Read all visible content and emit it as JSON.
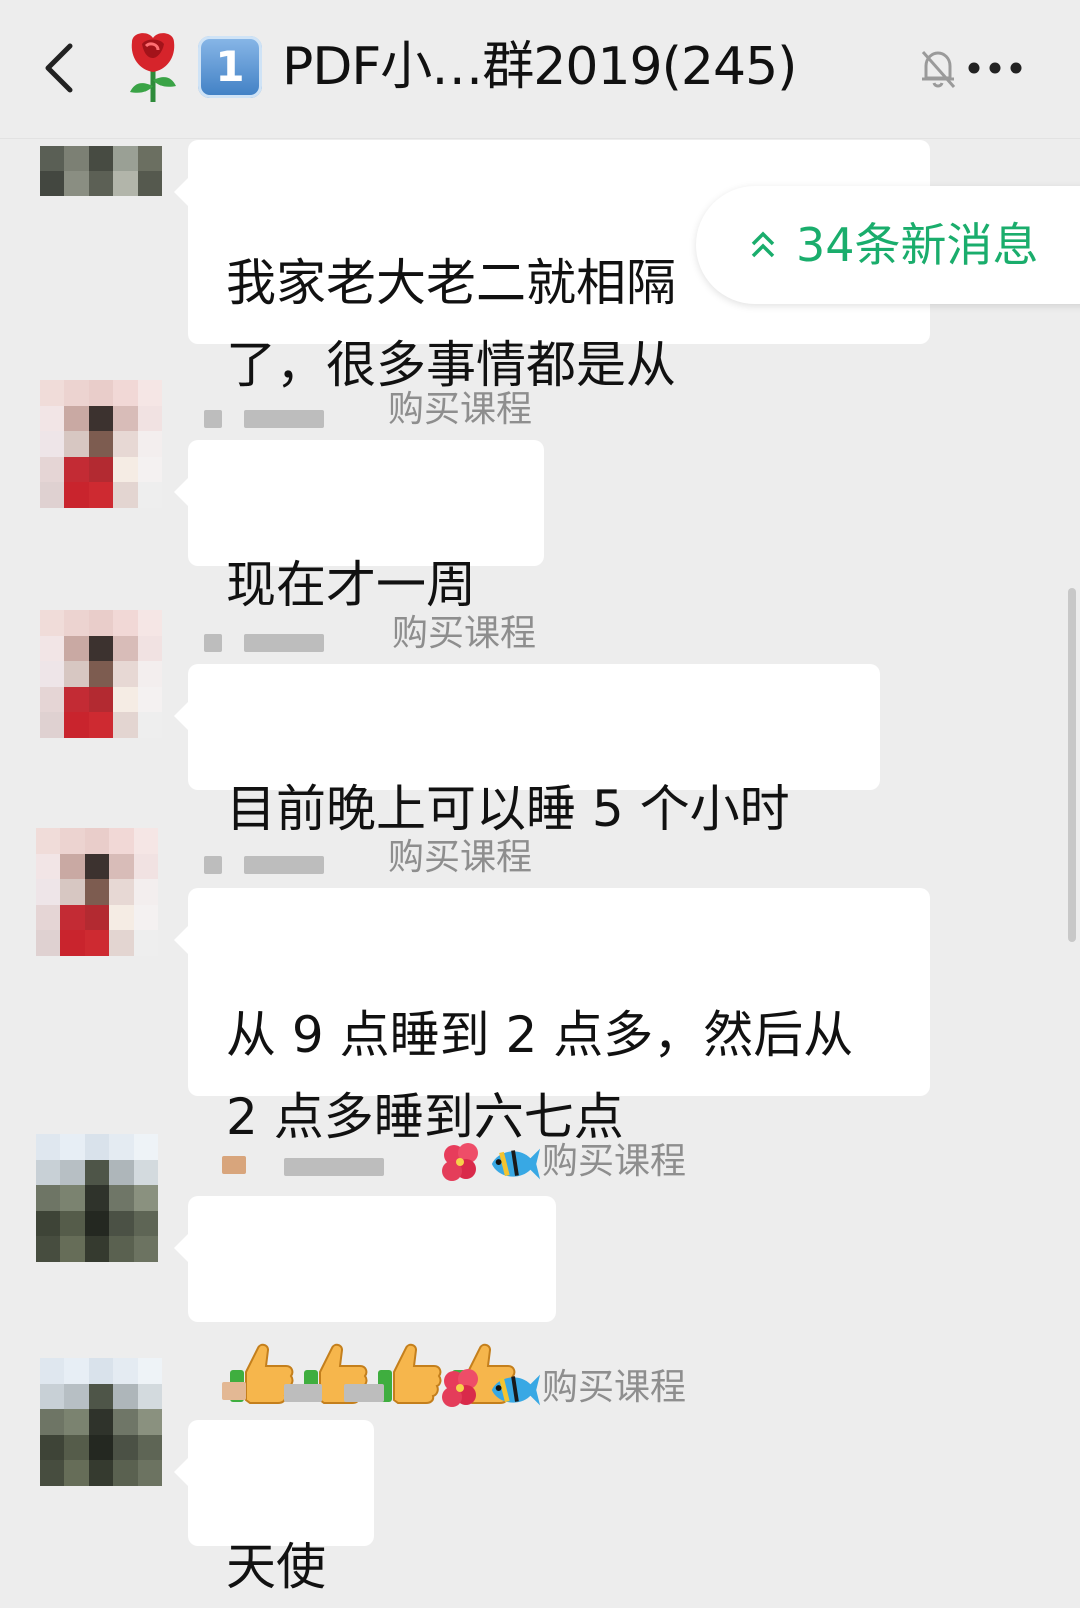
{
  "header": {
    "title": "PDF小…群2019(245)",
    "badge_number": "1"
  },
  "new_messages_label": "34条新消息",
  "messages": [
    {
      "tag": "",
      "text": "我家老大老二就相隔\n了，很多事情都是从"
    },
    {
      "tag": "购买课程",
      "text": "现在才一周"
    },
    {
      "tag": "购买课程",
      "text": "目前晚上可以睡 5 个小时"
    },
    {
      "tag": "购买课程",
      "text": "从 9 点睡到 2 点多，然后从\n2 点多睡到六七点"
    },
    {
      "tag": "购买课程",
      "text": ""
    },
    {
      "tag": "购买课程",
      "text": "天使"
    }
  ],
  "icons": {
    "back": "chevron-left-icon",
    "rose": "rose-emoji-icon",
    "mute": "bell-muted-icon",
    "more": "more-dots-icon",
    "thumbs_up": "thumbs-up-emoji-icon",
    "hibiscus": "hibiscus-emoji-icon",
    "fish": "tropical-fish-emoji-icon"
  },
  "thumbs_up_count": 4,
  "colors": {
    "background": "#ededed",
    "bubble": "#ffffff",
    "accent_green": "#1aad6c",
    "tag_gray": "#8e8e8e"
  }
}
